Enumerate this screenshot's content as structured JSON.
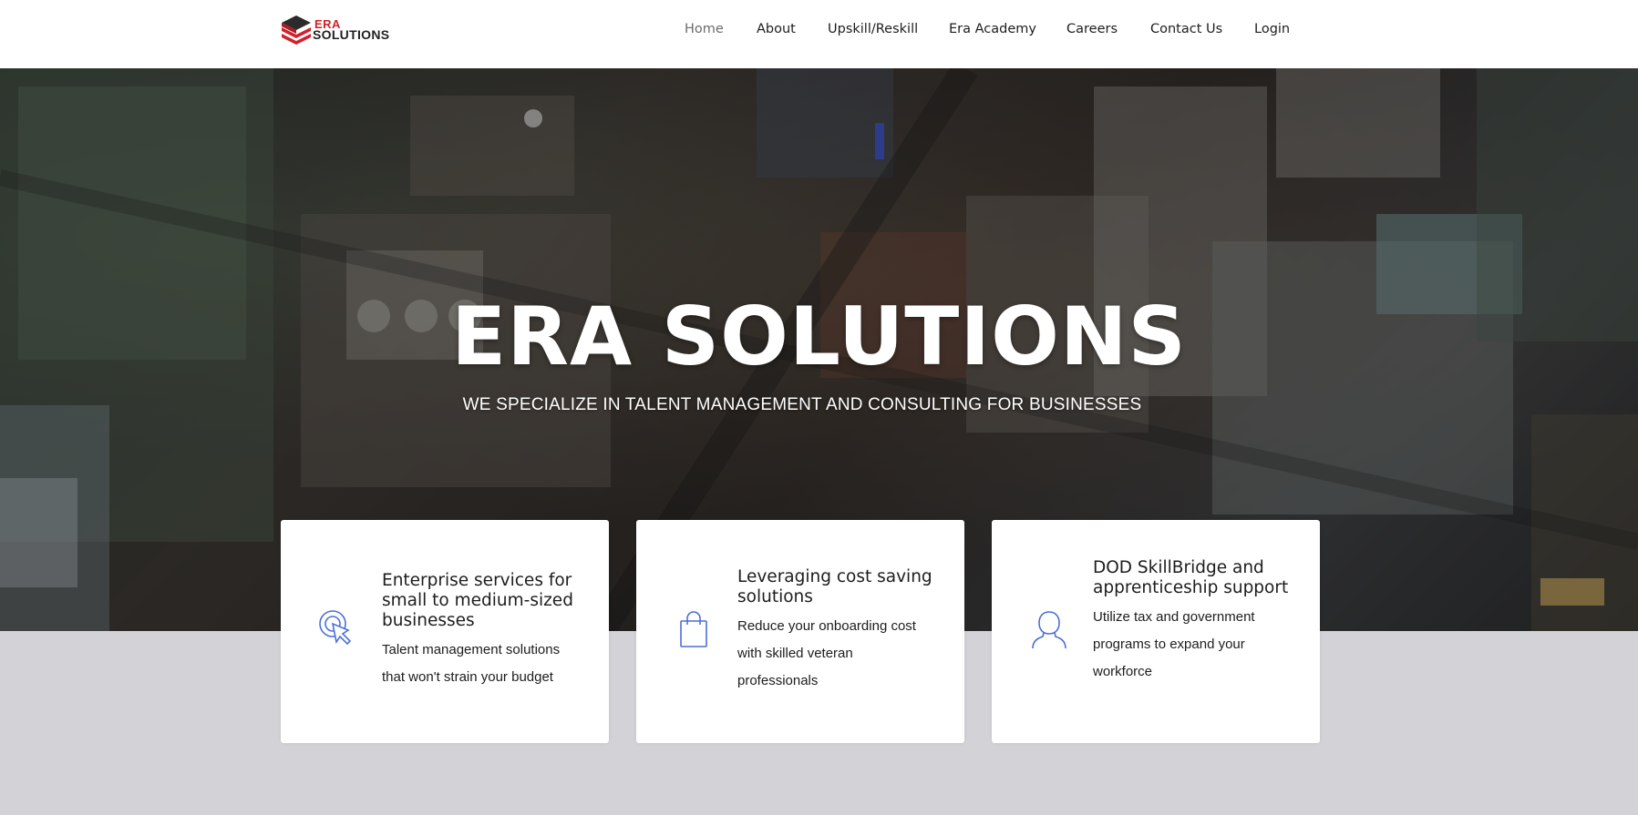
{
  "header": {
    "logo": {
      "line1": "ERA",
      "line2": "SOLUTIONS",
      "colors": {
        "red": "#d3202a",
        "dark": "#222222"
      }
    },
    "nav": [
      {
        "label": "Home",
        "active": true
      },
      {
        "label": "About"
      },
      {
        "label": "Upskill/Reskill"
      },
      {
        "label": "Era Academy"
      },
      {
        "label": "Careers"
      },
      {
        "label": "Contact Us"
      },
      {
        "label": "Login"
      }
    ]
  },
  "hero": {
    "title": "ERA SOLUTIONS",
    "subtitle": "WE SPECIALIZE IN TALENT MANAGEMENT AND CONSULTING FOR BUSINESSES"
  },
  "cards": [
    {
      "icon": "cursor-click-icon",
      "title": "Enterprise services for small to medium-sized businesses",
      "text": "Talent management solutions that won't strain your budget"
    },
    {
      "icon": "shopping-bag-icon",
      "title": "Leveraging cost saving solutions",
      "text": "Reduce your onboarding cost with skilled veteran professionals"
    },
    {
      "icon": "user-icon",
      "title": "DOD SkillBridge and apprenticeship support",
      "text": "Utilize tax and government programs to expand your workforce"
    }
  ],
  "colors": {
    "accent": "#4a6fd8",
    "page_background": "#d3d3d7",
    "header_background": "#ffffff"
  }
}
